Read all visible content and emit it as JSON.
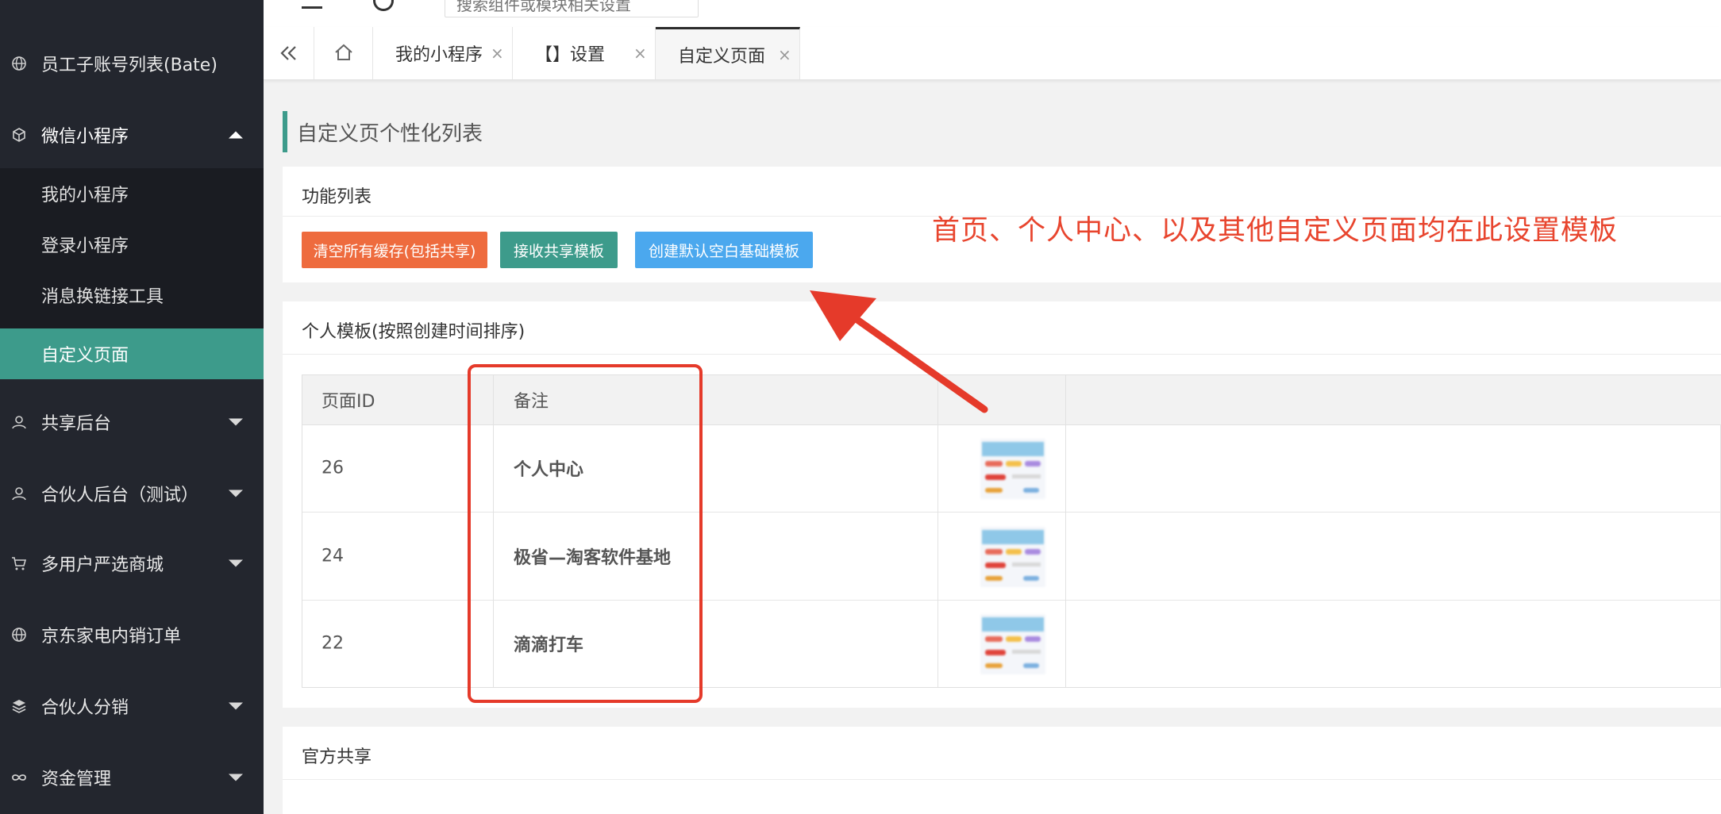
{
  "sidebar": {
    "items": [
      {
        "label": "员工子账号列表(Bate)",
        "icon": "globe-icon"
      },
      {
        "label": "微信小程序",
        "icon": "cube-icon"
      },
      {
        "label": "共享后台",
        "icon": "user-icon"
      },
      {
        "label": "合伙人后台（测试）",
        "icon": "user-icon"
      },
      {
        "label": "多用户严选商城",
        "icon": "cart-icon"
      },
      {
        "label": "京东家电内销订单",
        "icon": "globe-icon"
      },
      {
        "label": "合伙人分销",
        "icon": "layers-icon"
      },
      {
        "label": "资金管理",
        "icon": "link-icon"
      }
    ],
    "submenu": [
      {
        "label": "我的小程序"
      },
      {
        "label": "登录小程序"
      },
      {
        "label": "消息换链接工具"
      },
      {
        "label": "自定义页面"
      }
    ]
  },
  "header": {
    "search_placeholder": "搜索组件或模块相关设置"
  },
  "tabs": [
    {
      "label": "我的小程序",
      "close": "×"
    },
    {
      "label": "【】设置",
      "close": "×"
    },
    {
      "label": "自定义页面",
      "close": "×"
    }
  ],
  "main": {
    "heading": "自定义页个性化列表",
    "function_card": {
      "title": "功能列表",
      "buttons": [
        {
          "label": "清空所有缓存(包括共享)",
          "color": "#ee6b3e"
        },
        {
          "label": "接收共享模板",
          "color": "#3d9b8b"
        },
        {
          "label": "创建默认空白基础模板",
          "color": "#4ba8ee"
        }
      ]
    },
    "annotation": "首页、个人中心、以及其他自定义页面均在此设置模板",
    "template_card": {
      "title": "个人模板(按照创建时间排序)",
      "columns": [
        "页面ID",
        "备注",
        "",
        ""
      ],
      "rows": [
        {
          "id": "26",
          "note": "个人中心"
        },
        {
          "id": "24",
          "note": "极省—淘客软件基地"
        },
        {
          "id": "22",
          "note": "滴滴打车"
        }
      ]
    },
    "official_card": {
      "title": "官方共享"
    }
  },
  "colors": {
    "sidebar_bg": "#23262e",
    "accent": "#3d9b8b",
    "annotation_red": "#e53a2a"
  }
}
